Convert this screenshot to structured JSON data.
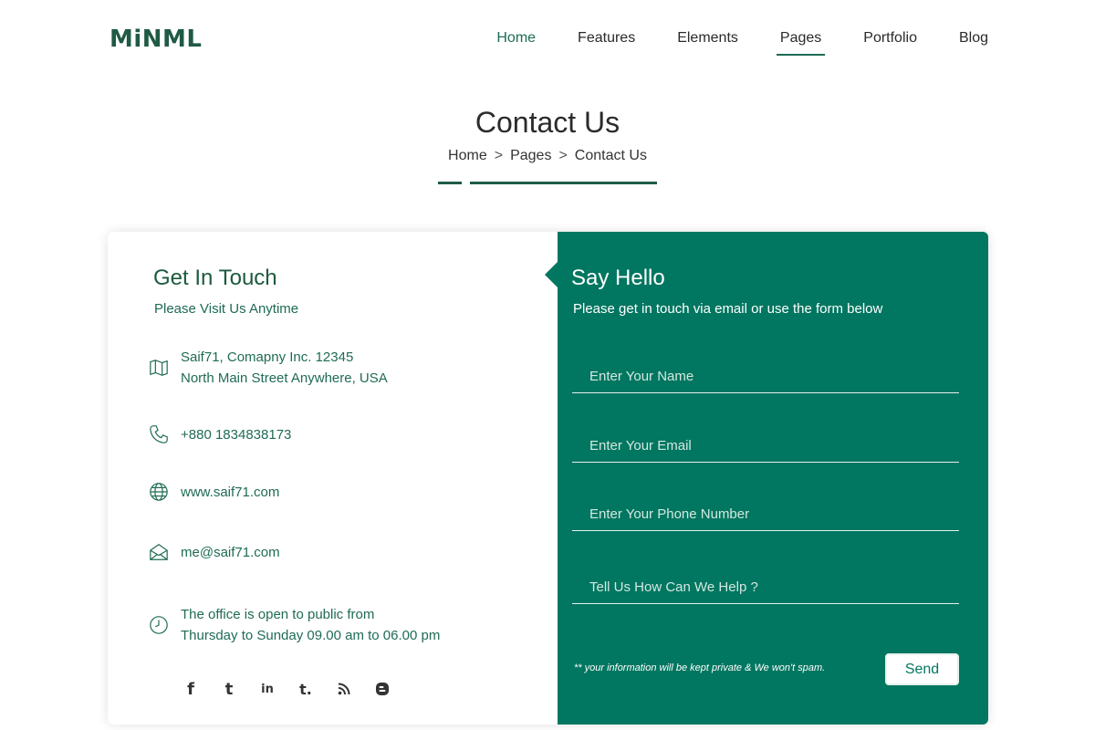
{
  "brand": {
    "logo_text": "MiNML",
    "accent": "#017660",
    "dark_green": "#1f5a44"
  },
  "nav": {
    "items": [
      {
        "label": "Home"
      },
      {
        "label": "Features"
      },
      {
        "label": "Elements"
      },
      {
        "label": "Pages"
      },
      {
        "label": "Portfolio"
      },
      {
        "label": "Blog"
      }
    ],
    "active": "Home",
    "current": "Pages"
  },
  "page": {
    "title": "Contact Us",
    "breadcrumb": [
      "Home",
      "Pages",
      "Contact Us"
    ],
    "breadcrumb_sep": ">"
  },
  "contact": {
    "title": "Get In Touch",
    "subtitle": "Please Visit Us Anytime",
    "address_line1": "Saif71, Comapny Inc. 12345",
    "address_line2": "North Main Street Anywhere, USA",
    "phone": "+880 1834838173",
    "website": "www.saif71.com",
    "email": "me@saif71.com",
    "hours_line1": "The office is open to public from",
    "hours_line2": "Thursday to Sunday 09.00 am to 06.00 pm",
    "icons": [
      "map-icon",
      "phone-icon",
      "globe-icon",
      "envelope-icon",
      "clock-icon"
    ],
    "social": [
      {
        "name": "facebook-icon",
        "glyph": "f"
      },
      {
        "name": "twitter-icon",
        "glyph": "t"
      },
      {
        "name": "linkedin-icon",
        "glyph": "in"
      },
      {
        "name": "tumblr-icon",
        "glyph": "t."
      },
      {
        "name": "rss-icon",
        "glyph": ""
      },
      {
        "name": "blogger-icon",
        "glyph": ""
      }
    ]
  },
  "form": {
    "title": "Say Hello",
    "subtitle": "Please get in touch via email or use the form below",
    "name_placeholder": "Enter Your Name",
    "email_placeholder": "Enter Your Email",
    "phone_placeholder": "Enter Your Phone Number",
    "message_placeholder": "Tell Us How Can We Help ?",
    "privacy_note": "** your information will be kept private & We won't spam.",
    "send_label": "Send"
  }
}
